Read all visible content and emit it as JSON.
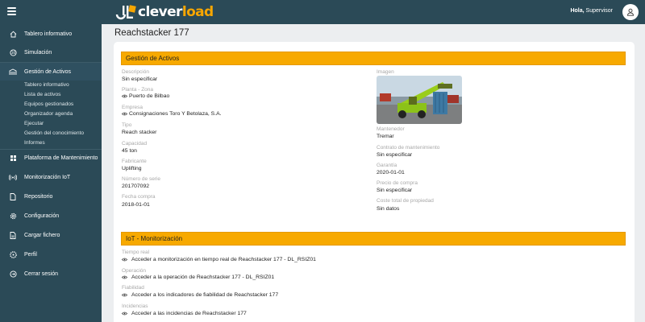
{
  "header": {
    "logo_clever": "clever",
    "logo_load": "load",
    "greeting_hola": "Hola,",
    "greeting_user": "Supervisor"
  },
  "colors": {
    "topbar": "#2b4a57",
    "accent": "#f7a900",
    "logo_load": "#f7a600"
  },
  "sidebar": {
    "items": [
      {
        "label": "Tablero informativo",
        "icon": "home-icon"
      },
      {
        "label": "Simulación",
        "icon": "simulation-icon"
      },
      {
        "label": "Gestión de Activos",
        "icon": "assets-icon"
      },
      {
        "label": "Plataforma de Mantenimiento",
        "icon": "maintenance-icon"
      },
      {
        "label": "Monitorización IoT",
        "icon": "iot-icon"
      },
      {
        "label": "Repositorio",
        "icon": "file-icon"
      },
      {
        "label": "Configuración",
        "icon": "gear-icon"
      },
      {
        "label": "Cargar fichero",
        "icon": "upload-file-icon"
      },
      {
        "label": "Perfil",
        "icon": "profile-icon"
      },
      {
        "label": "Cerrar sesión",
        "icon": "logout-icon"
      }
    ],
    "subitems": [
      "Tablero informativo",
      "Lista de activos",
      "Equipos gestionados",
      "Organizador agenda",
      "Ejecutar",
      "Gestión del conocimiento",
      "Informes"
    ]
  },
  "page": {
    "title": "Reachstacker 177"
  },
  "assets_section": {
    "title": "Gestión de Activos",
    "left_fields": [
      {
        "label": "Descripción",
        "value": "Sin especificar"
      },
      {
        "label": "Planta - Zona",
        "value": "Puerto de Bilbao"
      },
      {
        "label": "Empresa",
        "value": "Consignaciones Toro Y Betolaza, S.A."
      },
      {
        "label": "Tipo",
        "value": "Reach stacker"
      },
      {
        "label": "Capacidad",
        "value": "45 ton"
      },
      {
        "label": "Fabricante",
        "value": "Uplifting"
      },
      {
        "label": "Número de serie",
        "value": "201707092"
      },
      {
        "label": "Fecha compra",
        "value": "2018-01-01"
      }
    ],
    "image_label": "Imagen",
    "right_fields": [
      {
        "label": "Mantenedor",
        "value": "Tremar"
      },
      {
        "label": "Contrato de mantenimiento",
        "value": "Sin especificar"
      },
      {
        "label": "Garantía",
        "value": "2020-01-01"
      },
      {
        "label": "Precio de compra",
        "value": "Sin especificar"
      },
      {
        "label": "Coste total de propiedad",
        "value": "Sin datos"
      }
    ]
  },
  "iot_section": {
    "title": "IoT - Monitorización",
    "fields": [
      {
        "label": "Tiempo real",
        "value": "Acceder a monitorización en tiempo real de Reachstacker 177 - DL_RSIZ01"
      },
      {
        "label": "Operación",
        "value": "Acceder a la operación de Reachstacker 177 - DL_RSIZ01"
      },
      {
        "label": "Fiabilidad",
        "value": "Acceder a los indicadores de fiabilidad de Reachstacker 177"
      },
      {
        "label": "Incidencias",
        "value": "Acceder a las incidencias de Reachstacker 177"
      }
    ]
  }
}
